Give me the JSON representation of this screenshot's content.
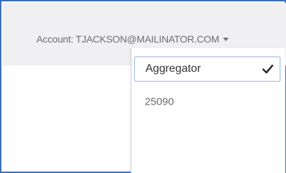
{
  "header": {
    "account_label": "Account: TJACKSON@MAILINATOR.COM"
  },
  "dropdown": {
    "items": [
      {
        "label": "Aggregator",
        "selected": true,
        "icon": "checkmark-icon"
      },
      {
        "label": "25090",
        "selected": false
      }
    ]
  },
  "colors": {
    "frame_border": "#3b6fb6",
    "header_background": "#f0f0f3",
    "selected_item_border": "#9ab6e0"
  }
}
